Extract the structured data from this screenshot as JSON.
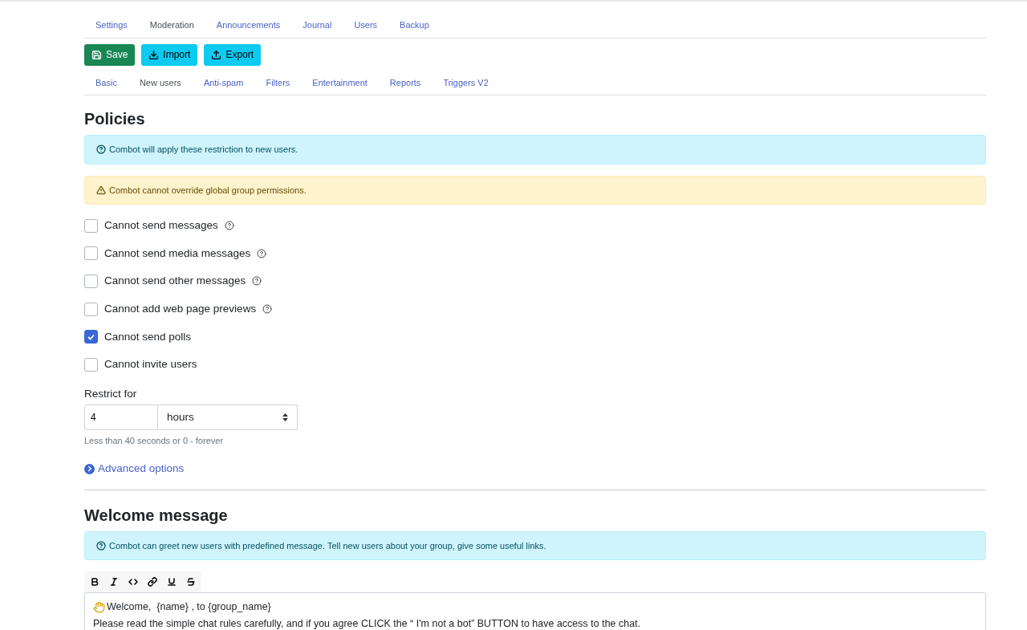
{
  "top_tabs": [
    {
      "label": "Settings",
      "selected": false
    },
    {
      "label": "Moderation",
      "selected": true
    },
    {
      "label": "Announcements",
      "selected": false
    },
    {
      "label": "Journal",
      "selected": false
    },
    {
      "label": "Users",
      "selected": false
    },
    {
      "label": "Backup",
      "selected": false
    }
  ],
  "actions": [
    {
      "label": "Save",
      "kind": "save"
    },
    {
      "label": "Import",
      "kind": "import"
    },
    {
      "label": "Export",
      "kind": "export"
    }
  ],
  "sub_tabs": [
    {
      "label": "Basic",
      "selected": false
    },
    {
      "label": "New users",
      "selected": true
    },
    {
      "label": "Anti-spam",
      "selected": false
    },
    {
      "label": "Filters",
      "selected": false
    },
    {
      "label": "Entertainment",
      "selected": false
    },
    {
      "label": "Reports",
      "selected": false
    },
    {
      "label": "Triggers V2",
      "selected": false
    }
  ],
  "policies": {
    "title": "Policies",
    "alerts": [
      {
        "kind": "info",
        "text": "Combot will apply these restriction to new users."
      },
      {
        "kind": "warning",
        "text": "Combot cannot override global group permissions."
      }
    ],
    "options": [
      {
        "label": "Cannot send messages",
        "checked": false,
        "help": true
      },
      {
        "label": "Cannot send media messages",
        "checked": false,
        "help": true
      },
      {
        "label": "Cannot send other messages",
        "checked": false,
        "help": true
      },
      {
        "label": "Cannot add web page previews",
        "checked": false,
        "help": true
      },
      {
        "label": "Cannot send polls",
        "checked": true,
        "help": false
      },
      {
        "label": "Cannot invite users",
        "checked": false,
        "help": false
      }
    ],
    "restrict": {
      "label": "Restrict for",
      "value": "4",
      "unit": "hours",
      "hint": "Less than 40 seconds or 0 - forever"
    },
    "advanced_link": "Advanced options"
  },
  "welcome": {
    "title": "Welcome message",
    "alert": {
      "kind": "info",
      "text": "Combot can greet new users with predefined message. Tell new users about your group, give some useful links."
    },
    "editor_lines": [
      "Welcome,  {name} , to {group_name}",
      "Please read the simple chat rules carefully, and if you agree CLICK the “ I'm not a bot” BUTTON to have access to the chat."
    ]
  }
}
